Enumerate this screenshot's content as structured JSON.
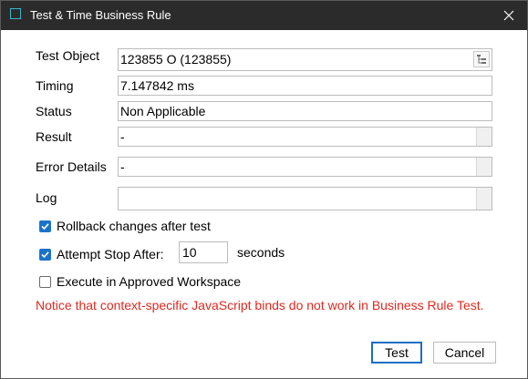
{
  "window": {
    "title": "Test & Time Business Rule"
  },
  "form": {
    "test_object": {
      "label": "Test Object",
      "value": "123855 O (123855)"
    },
    "timing": {
      "label": "Timing",
      "value": "7.147842 ms"
    },
    "status": {
      "label": "Status",
      "value": "Non Applicable"
    },
    "result": {
      "label": "Result",
      "value": "-"
    },
    "error_details": {
      "label": "Error Details",
      "value": "-"
    },
    "log": {
      "label": "Log",
      "value": ""
    }
  },
  "options": {
    "rollback": {
      "label": "Rollback changes after test",
      "checked": true
    },
    "attempt_stop": {
      "label": "Attempt Stop After:",
      "checked": true,
      "value": "10",
      "unit": "seconds"
    },
    "approved_workspace": {
      "label": "Execute in Approved Workspace",
      "checked": false
    }
  },
  "notice": "Notice that context-specific JavaScript binds do not work in Business Rule Test.",
  "buttons": {
    "test": "Test",
    "cancel": "Cancel"
  },
  "colors": {
    "titlebar": "#2b2b2b",
    "accent": "#1a73c9",
    "notice": "#e0281e"
  },
  "icons": {
    "app": "app-icon",
    "close": "close-icon",
    "tree": "tree-picker-icon",
    "check": "checkmark-icon"
  }
}
